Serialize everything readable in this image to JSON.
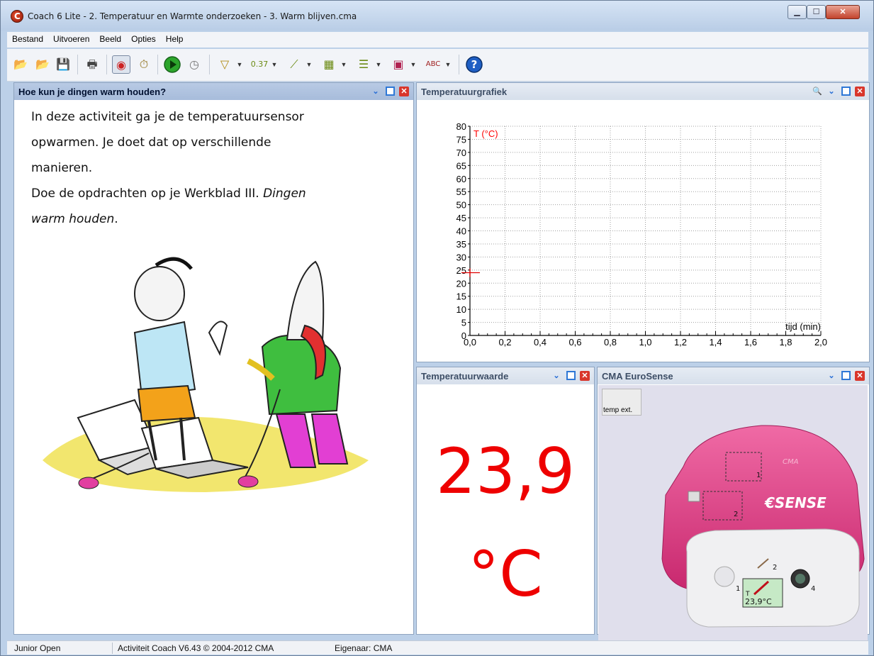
{
  "window": {
    "title": "Coach 6 Lite - 2. Temperatuur en Warmte onderzoeken - 3. Warm blijven.cma"
  },
  "menu": [
    "Bestand",
    "Uitvoeren",
    "Beeld",
    "Opties",
    "Help"
  ],
  "toolbar": {
    "icons": [
      "open-activity-icon",
      "open-result-icon",
      "save-icon",
      "print-icon",
      "sensor-setup-icon",
      "timer-icon",
      "start-icon",
      "stop-icon",
      "diagram-icon",
      "meter-icon",
      "graph-icon",
      "table-icon",
      "text-icon",
      "video-icon",
      "spelling-icon",
      "help-icon"
    ]
  },
  "text_panel": {
    "title": "Hoe kun je dingen warm houden?",
    "line1": "In deze activiteit ga je de temperatuursensor",
    "line2": "opwarmen. Je doet dat op verschillende",
    "line3": "manieren.",
    "line4_plain": "Doe de opdrachten op je Werkblad III. ",
    "line4_italic": "Dingen",
    "line5_italic": "warm houden",
    "line5_end": "."
  },
  "graph_panel": {
    "title": "Temperatuurgrafiek"
  },
  "chart_data": {
    "type": "line",
    "ylabel": "T (°C)",
    "xlabel": "tijd (min)",
    "ylim": [
      0,
      80
    ],
    "xlim": [
      0,
      2
    ],
    "yticks": [
      "0",
      "5",
      "10",
      "15",
      "20",
      "25",
      "30",
      "35",
      "40",
      "45",
      "50",
      "55",
      "60",
      "65",
      "70",
      "75",
      "80"
    ],
    "xticks": [
      "0,0",
      "0,2",
      "0,4",
      "0,6",
      "0,8",
      "1,0",
      "1,2",
      "1,4",
      "1,6",
      "1,8",
      "2,0"
    ],
    "grid": true,
    "series": [],
    "marker_y": 24,
    "colors": {
      "label": "#ff0000",
      "grid": "#a0a0a0",
      "marker": "#e00000"
    }
  },
  "meter_panel": {
    "title": "Temperatuurwaarde",
    "value": "23,9",
    "unit": "°C",
    "color": "#ee0000"
  },
  "eurosense_panel": {
    "title": "CMA EuroSense",
    "temp_button": "temp ext.",
    "port1": "1",
    "port2": "2",
    "port1_front": "1",
    "port2_front": "2",
    "port4_front": "4",
    "sensor_label": "T",
    "sensor_value": "23,9°C",
    "logo": "€SENSE",
    "brand": "CMA",
    "color": "#e8488a"
  },
  "statusbar": {
    "mode": "Junior Open",
    "activity": "Activiteit Coach V6.43 © 2004-2012 CMA",
    "owner": "Eigenaar: CMA"
  }
}
